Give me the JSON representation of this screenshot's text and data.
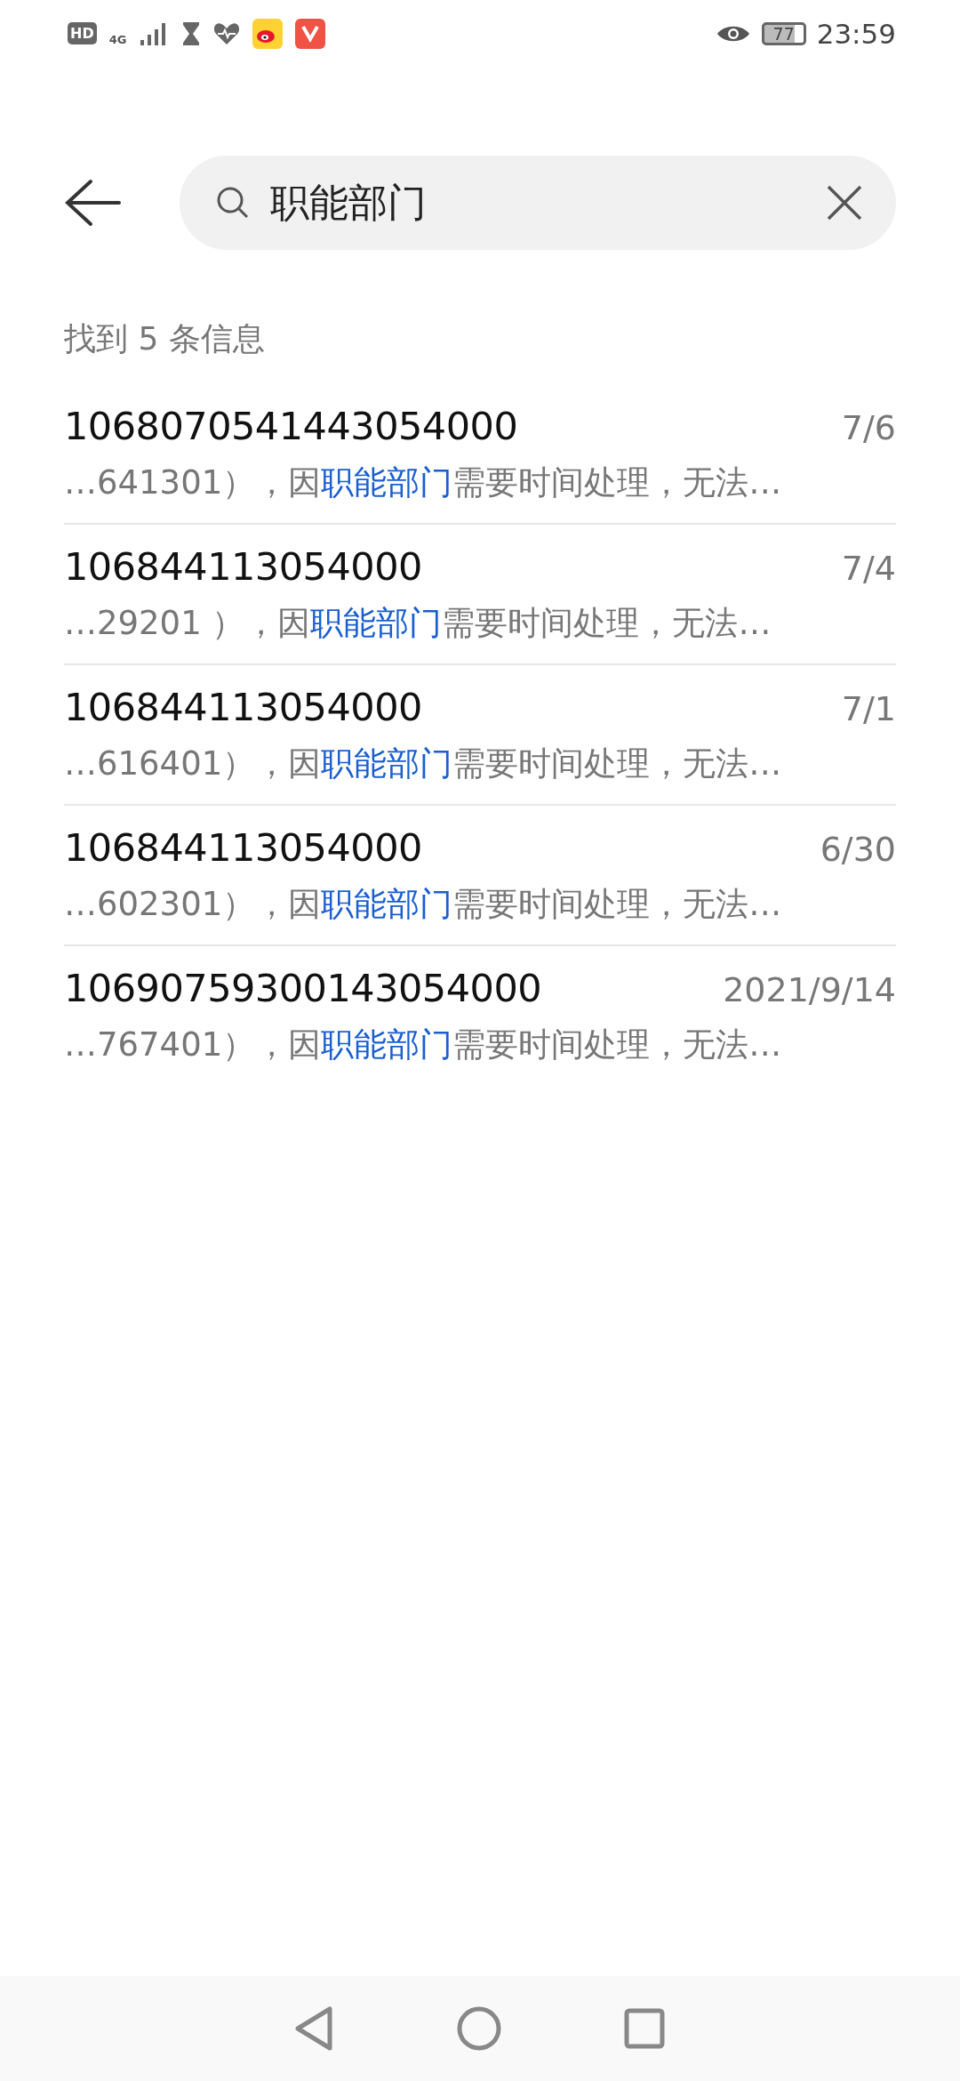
{
  "status_bar": {
    "network_badge": "HD",
    "network_type": "4G",
    "battery": "77",
    "time": "23:59"
  },
  "search": {
    "value": "职能部门"
  },
  "result_count": "找到 5 条信息",
  "results": [
    {
      "sender": "1068070541443054000",
      "date": "7/6",
      "snippet": {
        "before": "…641301），因",
        "match": "职能部门",
        "after": "需要时间处理，无法…"
      }
    },
    {
      "sender": "106844113054000",
      "date": "7/4",
      "snippet": {
        "before": "…29201 ），因",
        "match": "职能部门",
        "after": "需要时间处理，无法…"
      }
    },
    {
      "sender": "106844113054000",
      "date": "7/1",
      "snippet": {
        "before": "…616401），因",
        "match": "职能部门",
        "after": "需要时间处理，无法…"
      }
    },
    {
      "sender": "106844113054000",
      "date": "6/30",
      "snippet": {
        "before": "…602301），因",
        "match": "职能部门",
        "after": "需要时间处理，无法…"
      }
    },
    {
      "sender": "10690759300143054000",
      "date": "2021/9/14",
      "snippet": {
        "before": "…767401），因",
        "match": "职能部门",
        "after": "需要时间处理，无法…"
      }
    }
  ]
}
